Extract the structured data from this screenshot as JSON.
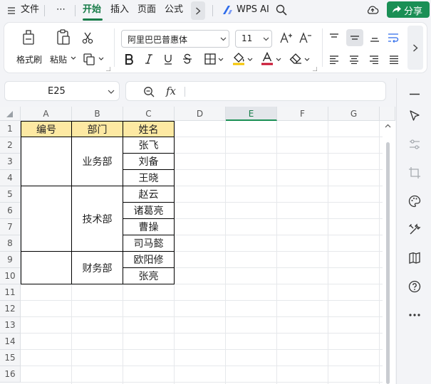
{
  "menu": {
    "file": "文件",
    "more": "⋯",
    "tabs": [
      "开始",
      "插入",
      "页面",
      "公式"
    ],
    "wps_ai": "WPS AI",
    "share": "分享"
  },
  "ribbon": {
    "format_painter": "格式刷",
    "paste": "粘贴",
    "font_name": "阿里巴巴普惠体",
    "font_size": "11"
  },
  "formula_bar": {
    "cell_ref": "E25",
    "fx": "fx",
    "content": ""
  },
  "sheet": {
    "columns": [
      "A",
      "B",
      "C",
      "D",
      "E",
      "F",
      "G"
    ],
    "selected_column": "E",
    "rows": [
      "1",
      "2",
      "3",
      "4",
      "5",
      "6",
      "7",
      "8",
      "9",
      "10",
      "11",
      "12",
      "13",
      "14",
      "15",
      "16"
    ],
    "headers": [
      "编号",
      "部门",
      "姓名"
    ],
    "departments": [
      "业务部",
      "技术部",
      "财务部"
    ],
    "names": [
      "张飞",
      "刘备",
      "王晓",
      "赵云",
      "诸葛亮",
      "曹操",
      "司马懿",
      "欧阳修",
      "张亮"
    ]
  },
  "colors": {
    "accent": "#1a8f55",
    "header_fill": "#fde9a3",
    "font_color_bar": "#c8102e",
    "fill_color_bar": "#f5c400"
  }
}
